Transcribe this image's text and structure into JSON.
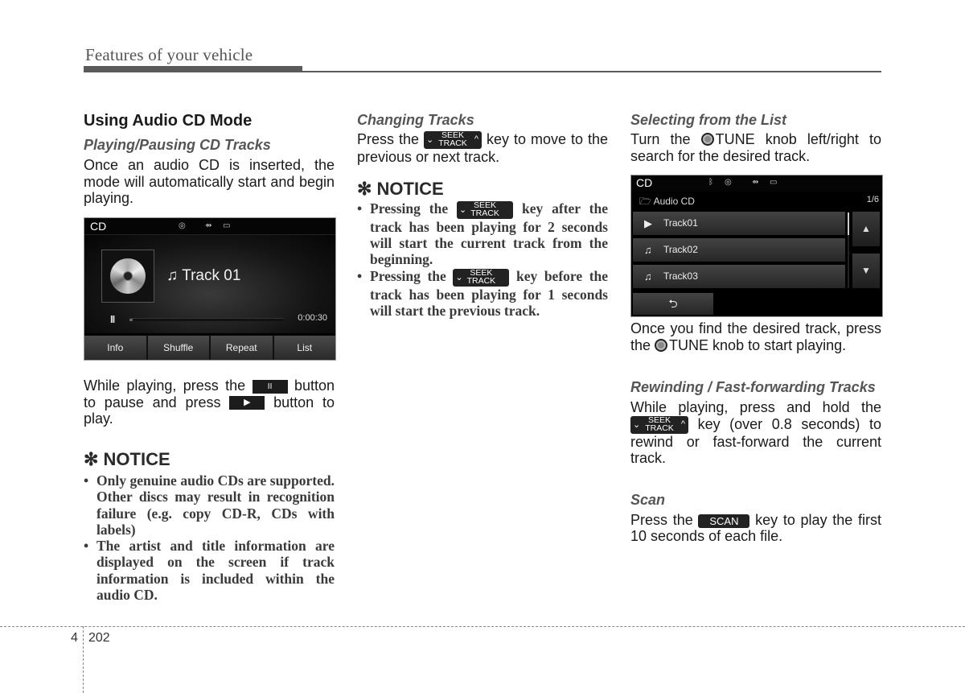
{
  "header": {
    "title": "Features of your vehicle"
  },
  "col1": {
    "section_title": "Using Audio CD Mode",
    "sub_playing": "Playing/Pausing CD Tracks",
    "para_intro": "Once an audio CD is inserted, the mode will automatically start and begin playing.",
    "para_pause_1": "While playing, press the",
    "para_pause_2": "button to pause and press",
    "para_pause_3": "button to play.",
    "pause_key_label": "II",
    "play_key_label": "▶",
    "notice_title": "✻ NOTICE",
    "notice_items": [
      "Only genuine audio CDs are supported. Other discs may result in recognition failure (e.g. copy CD-R, CDs with labels)",
      "The artist and title information are displayed on the screen if track information is included within the audio CD."
    ]
  },
  "screen_playing": {
    "source": "CD",
    "status_icons": [
      "disc-icon",
      "usb-icon",
      "aux-icon"
    ],
    "track_title": "Track 01",
    "note_glyph": "♫",
    "pause_glyph": "II",
    "elapsed": "0:00:30",
    "progress": 0.02,
    "softkeys": [
      "Info",
      "Shuffle",
      "Repeat",
      "List"
    ]
  },
  "col2": {
    "sub_changing": "Changing Tracks",
    "para_changing_1": "Press the",
    "para_changing_2": "key to move to the previous or next track.",
    "notice_title": "✻ NOTICE",
    "notice_items": [
      {
        "pre": "Pressing the",
        "post": "key after the track has been playing for 2 seconds will start the current track from the beginning."
      },
      {
        "pre": "Pressing the",
        "post": "key before the track has been playing for 1 seconds will start the previous track."
      }
    ]
  },
  "keys": {
    "seek_top": "SEEK",
    "seek_bottom": "TRACK",
    "chevron_down": "⌄",
    "chevron_up": "^",
    "scan": "SCAN"
  },
  "col3": {
    "sub_selecting": "Selecting from the List",
    "para_select_1": "Turn the",
    "para_select_2": "TUNE knob left/right to search for the desired track.",
    "para_found_1": "Once you find the desired track, press the",
    "para_found_2": "TUNE knob to start playing.",
    "sub_rewind": "Rewinding / Fast-forwarding Tracks",
    "para_rewind_1": "While playing, press and hold the",
    "para_rewind_2": "key (over 0.8 seconds) to rewind or fast-forward the current track.",
    "sub_scan": "Scan",
    "para_scan_1": "Press the",
    "para_scan_2": "key to play the first 10 seconds of each file."
  },
  "screen_list": {
    "source": "CD",
    "status_icons": [
      "bluetooth-icon",
      "disc-icon",
      "usb-icon",
      "aux-icon"
    ],
    "folder": "Audio CD",
    "page": "1/6",
    "tracks": [
      {
        "label": "Track01",
        "icon": "play-circle-icon",
        "glyph": "▶"
      },
      {
        "label": "Track02",
        "icon": "music-note-icon",
        "glyph": "♫"
      },
      {
        "label": "Track03",
        "icon": "music-note-icon",
        "glyph": "♫"
      }
    ],
    "up_glyph": "▲",
    "down_glyph": "▼",
    "back_glyph": "⮌"
  },
  "footer": {
    "chapter": "4",
    "page": "202"
  }
}
